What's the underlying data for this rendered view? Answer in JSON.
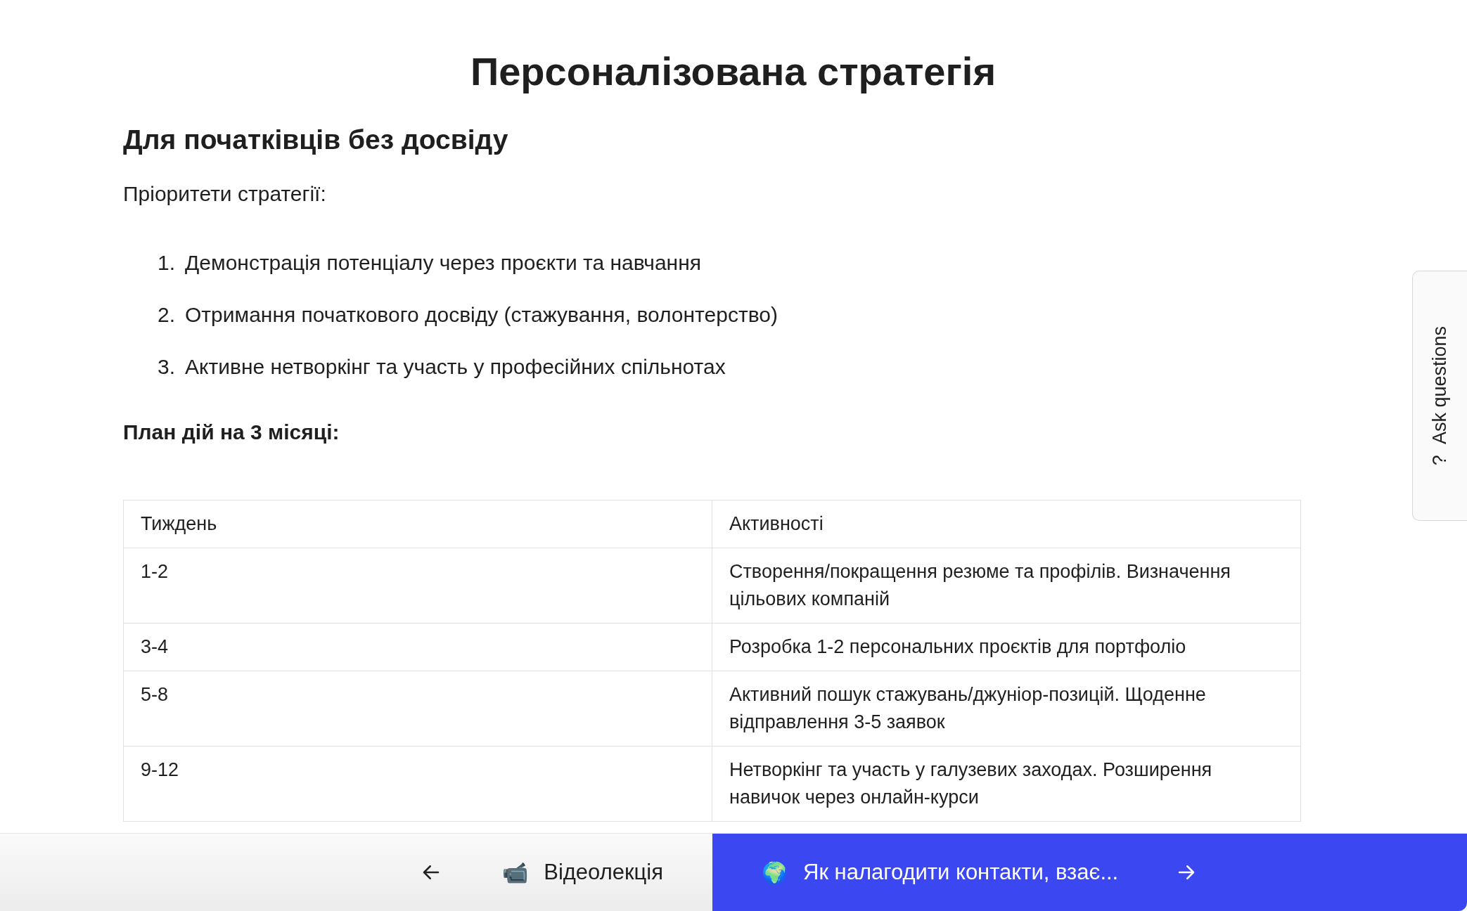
{
  "title": "Персоналізована стратегія",
  "section": {
    "heading": "Для початківців без досвіду",
    "intro": "Пріоритети стратегії:",
    "priorities": [
      {
        "number": "1.",
        "text": "Демонстрація потенціалу через проєкти та навчання"
      },
      {
        "number": "2.",
        "text": "Отримання початкового досвіду (стажування, волонтерство)"
      },
      {
        "number": "3.",
        "text": "Активне нетворкінг та участь у професійних спільнотах"
      }
    ],
    "plan_heading": "План дій на 3 місяці:"
  },
  "table": {
    "columns": [
      "Тиждень",
      "Активності"
    ],
    "rows": [
      [
        "1-2",
        "Створення/покращення резюме та профілів. Визначення цільових компаній"
      ],
      [
        "3-4",
        "Розробка 1-2 персональних проєктів для портфоліо"
      ],
      [
        "5-8",
        "Активний пошук стажувань/джуніор-позицій. Щоденне відправлення 3-5 заявок"
      ],
      [
        "9-12",
        "Нетворкінг та участь у галузевих заходах. Розширення навичок через онлайн-курси"
      ]
    ]
  },
  "side_tab": {
    "icon": "?",
    "label": "Ask questions"
  },
  "nav": {
    "previous": {
      "emoji": "📹",
      "label": "Відеолекція"
    },
    "next": {
      "emoji": "🌍",
      "label": "Як налагодити контакти, взає..."
    }
  }
}
